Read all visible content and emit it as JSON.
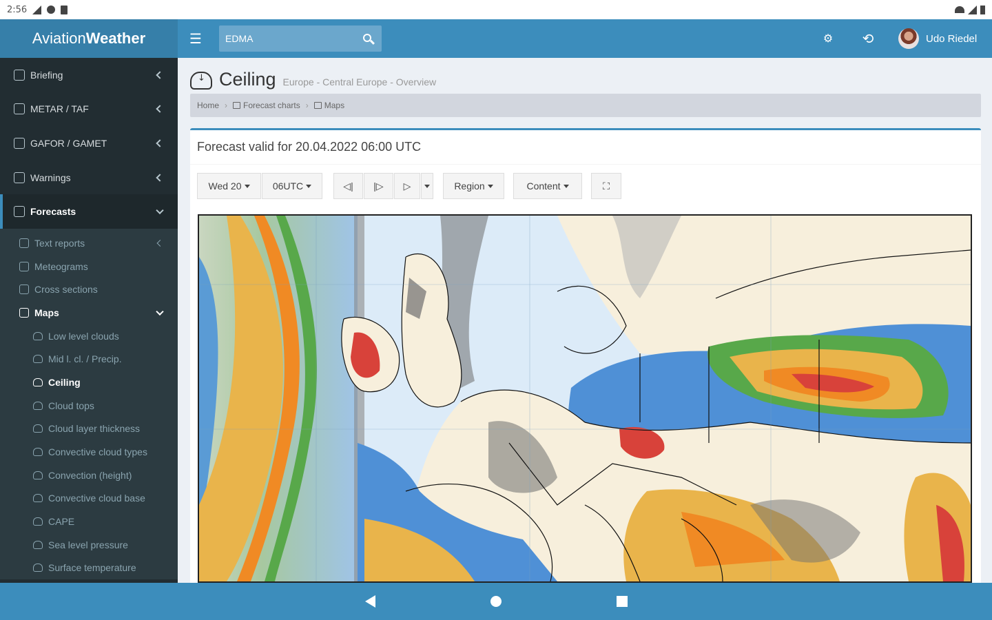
{
  "status_bar": {
    "time": "2:56"
  },
  "header": {
    "logo_light": "Aviation",
    "logo_bold": "Weather",
    "search_value": "EDMA",
    "settings_icon": "gear-icon",
    "refresh_icon": "refresh-icon",
    "user_name": "Udo Riedel"
  },
  "sidebar": {
    "items": [
      {
        "label": "Briefing",
        "icon": "briefing-icon"
      },
      {
        "label": "METAR / TAF",
        "icon": "metar-icon"
      },
      {
        "label": "GAFOR / GAMET",
        "icon": "gafor-icon"
      },
      {
        "label": "Warnings",
        "icon": "warnings-icon"
      },
      {
        "label": "Forecasts",
        "icon": "forecasts-icon"
      }
    ],
    "forecast_items": [
      {
        "label": "Text reports"
      },
      {
        "label": "Meteograms"
      },
      {
        "label": "Cross sections"
      },
      {
        "label": "Maps"
      }
    ],
    "map_items": [
      {
        "label": "Low level clouds"
      },
      {
        "label": "Mid l. cl. / Precip."
      },
      {
        "label": "Ceiling"
      },
      {
        "label": "Cloud tops"
      },
      {
        "label": "Cloud layer thickness"
      },
      {
        "label": "Convective cloud types"
      },
      {
        "label": "Convection (height)"
      },
      {
        "label": "Convective cloud base"
      },
      {
        "label": "CAPE"
      },
      {
        "label": "Sea level pressure"
      },
      {
        "label": "Surface temperature"
      }
    ]
  },
  "page": {
    "title": "Ceiling",
    "subtitle": "Europe - Central Europe - Overview",
    "breadcrumb": [
      "Home",
      "Forecast charts",
      "Maps"
    ],
    "valid_text": "Forecast valid for 20.04.2022 06:00 UTC"
  },
  "toolbar": {
    "day": "Wed 20",
    "time": "06UTC",
    "region": "Region",
    "content": "Content"
  },
  "colors": {
    "header": "#3c8dbc",
    "sidebar": "#222d32"
  }
}
